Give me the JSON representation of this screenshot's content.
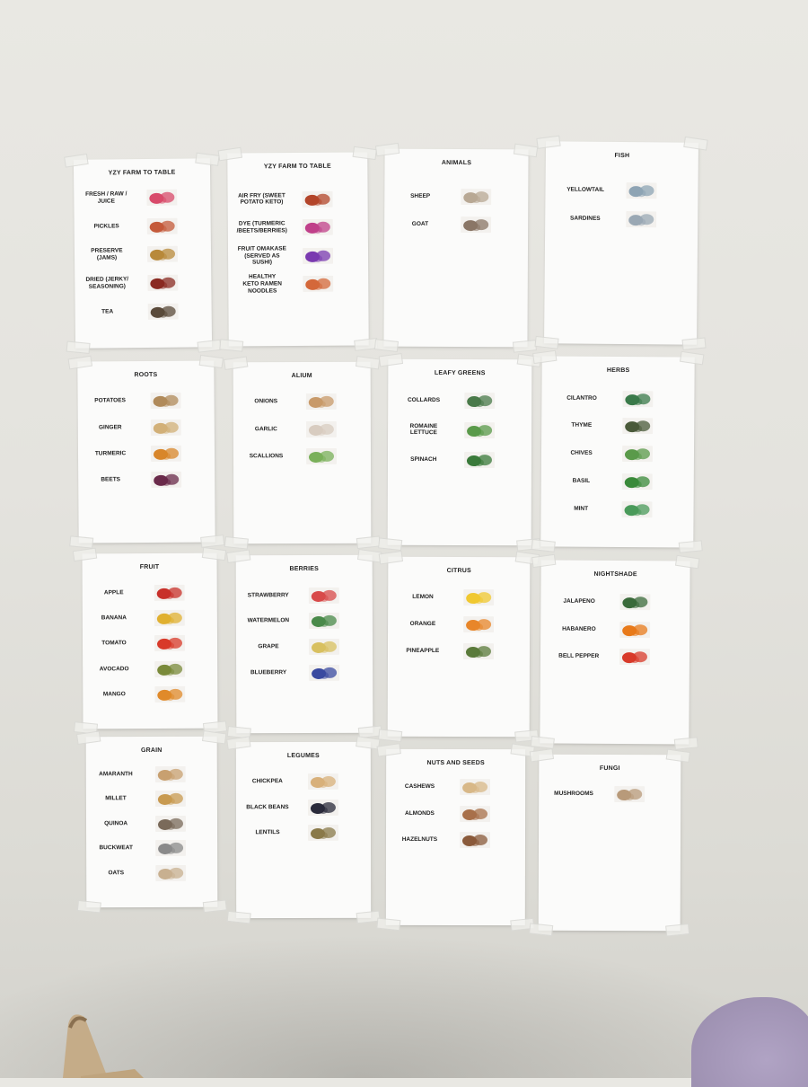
{
  "sheets": [
    {
      "title": "YZY FARM TO TABLE",
      "items": [
        {
          "label": "FRESH / RAW /\nJUICE",
          "img": "bottles-image",
          "color": "#d84a6a"
        },
        {
          "label": "PICKLES",
          "img": "pickle-jars-image",
          "color": "#c45a3a"
        },
        {
          "label": "PRESERVE\n(JAMS)",
          "img": "jam-spoons-image",
          "color": "#b8893a"
        },
        {
          "label": "DRIED (JERKY/\nSEASONING)",
          "img": "jerky-image",
          "color": "#8a2a22"
        },
        {
          "label": "TEA",
          "img": "tea-image",
          "color": "#5a4a3a"
        }
      ]
    },
    {
      "title": "YZY FARM TO TABLE",
      "items": [
        {
          "label": "AIR FRY (SWEET\nPOTATO KETO)",
          "img": "sweet-potato-fries-image",
          "color": "#b3452a"
        },
        {
          "label": "DYE (TURMERIC\n/BEETS/BERRIES)",
          "img": "dye-image",
          "color": "#c0408a"
        },
        {
          "label": "FRUIT OMAKASE\n(SERVED AS\nSUSHI)",
          "img": "fruit-sushi-image",
          "color": "#7a3ab0"
        },
        {
          "label": "HEALTHY\nKETO RAMEN\nNOODLES",
          "img": "ramen-packs-image",
          "color": "#d4683a"
        }
      ]
    },
    {
      "title": "ANIMALS",
      "items": [
        {
          "label": "SHEEP",
          "img": "sheep-image",
          "color": "#b8a894"
        },
        {
          "label": "GOAT",
          "img": "goat-image",
          "color": "#8a7666"
        }
      ]
    },
    {
      "title": "FISH",
      "items": [
        {
          "label": "YELLOWTAIL",
          "img": "yellowtail-image",
          "color": "#8ea4b4"
        },
        {
          "label": "SARDINES",
          "img": "sardines-image",
          "color": "#9aa8b4"
        }
      ]
    },
    {
      "title": "ROOTS",
      "items": [
        {
          "label": "POTATOES",
          "img": "potatoes-image",
          "color": "#b08a5a"
        },
        {
          "label": "GINGER",
          "img": "ginger-image",
          "color": "#d2b078"
        },
        {
          "label": "TURMERIC",
          "img": "turmeric-image",
          "color": "#d8862a"
        },
        {
          "label": "BEETS",
          "img": "beets-image",
          "color": "#6a2a4a"
        }
      ]
    },
    {
      "title": "ALIUM",
      "items": [
        {
          "label": "ONIONS",
          "img": "onions-image",
          "color": "#c89a6a"
        },
        {
          "label": "GARLIC",
          "img": "garlic-image",
          "color": "#d8ccc0"
        },
        {
          "label": "SCALLIONS",
          "img": "scallions-image",
          "color": "#7ab05a"
        }
      ]
    },
    {
      "title": "LEAFY GREENS",
      "items": [
        {
          "label": "COLLARDS",
          "img": "collards-image",
          "color": "#4a7a4a"
        },
        {
          "label": "ROMAINE\nLETTUCE",
          "img": "romaine-image",
          "color": "#5a9a4a"
        },
        {
          "label": "SPINACH",
          "img": "spinach-image",
          "color": "#3a7a3a"
        }
      ]
    },
    {
      "title": "HERBS",
      "items": [
        {
          "label": "CILANTRO",
          "img": "cilantro-image",
          "color": "#3a7a4a"
        },
        {
          "label": "THYME",
          "img": "thyme-image",
          "color": "#4a5a3a"
        },
        {
          "label": "CHIVES",
          "img": "chives-image",
          "color": "#5a9a4a"
        },
        {
          "label": "BASIL",
          "img": "basil-image",
          "color": "#3a8a3a"
        },
        {
          "label": "MINT",
          "img": "mint-image",
          "color": "#4a9a5a"
        }
      ]
    },
    {
      "title": "FRUIT",
      "items": [
        {
          "label": "APPLE",
          "img": "apple-image",
          "color": "#c8302a"
        },
        {
          "label": "BANANA",
          "img": "banana-image",
          "color": "#e0b030"
        },
        {
          "label": "TOMATO",
          "img": "tomato-image",
          "color": "#d83a2a"
        },
        {
          "label": "AVOCADO",
          "img": "avocado-image",
          "color": "#7a8a3a"
        },
        {
          "label": "MANGO",
          "img": "mango-image",
          "color": "#e08a2a"
        }
      ]
    },
    {
      "title": "BERRIES",
      "items": [
        {
          "label": "STRAWBERRY",
          "img": "strawberry-image",
          "color": "#d84a4a"
        },
        {
          "label": "WATERMELON",
          "img": "watermelon-image",
          "color": "#4a8a4a"
        },
        {
          "label": "GRAPE",
          "img": "grape-image",
          "color": "#d8c060"
        },
        {
          "label": "BLUEBERRY",
          "img": "blueberry-image",
          "color": "#3a4aa0"
        }
      ]
    },
    {
      "title": "CITRUS",
      "items": [
        {
          "label": "LEMON",
          "img": "lemon-image",
          "color": "#f0c830"
        },
        {
          "label": "ORANGE",
          "img": "orange-image",
          "color": "#e8862a"
        },
        {
          "label": "PINEAPPLE",
          "img": "pineapple-image",
          "color": "#5a7a3a"
        }
      ]
    },
    {
      "title": "NIGHTSHADE",
      "items": [
        {
          "label": "JALAPENO",
          "img": "jalapeno-image",
          "color": "#3a6a3a"
        },
        {
          "label": "HABANERO",
          "img": "habanero-image",
          "color": "#e87a1a"
        },
        {
          "label": "BELL PEPPER",
          "img": "bell-pepper-image",
          "color": "#d83a2a"
        }
      ]
    },
    {
      "title": "GRAIN",
      "items": [
        {
          "label": "AMARANTH",
          "img": "amaranth-image",
          "color": "#c8a070"
        },
        {
          "label": "MILLET",
          "img": "millet-image",
          "color": "#c89a50"
        },
        {
          "label": "QUINOA",
          "img": "quinoa-image",
          "color": "#7a6a5a"
        },
        {
          "label": "BUCKWEAT",
          "img": "buckwheat-image",
          "color": "#8a8a8a"
        },
        {
          "label": "OATS",
          "img": "oats-image",
          "color": "#c8b090"
        }
      ]
    },
    {
      "title": "LEGUMES",
      "items": [
        {
          "label": "CHICKPEA",
          "img": "chickpea-image",
          "color": "#d8b07a"
        },
        {
          "label": "BLACK BEANS",
          "img": "black-beans-image",
          "color": "#2a2a3a"
        },
        {
          "label": "LENTILS",
          "img": "lentils-image",
          "color": "#8a7a4a"
        }
      ]
    },
    {
      "title": "NUTS AND SEEDS",
      "items": [
        {
          "label": "CASHEWS",
          "img": "cashews-image",
          "color": "#d8b888"
        },
        {
          "label": "ALMONDS",
          "img": "almonds-image",
          "color": "#a8704a"
        },
        {
          "label": "HAZELNUTS",
          "img": "hazelnuts-image",
          "color": "#8a5a3a"
        }
      ]
    },
    {
      "title": "FUNGI",
      "items": [
        {
          "label": "MUSHROOMS",
          "img": "mushrooms-image",
          "color": "#b89a7a"
        }
      ]
    }
  ]
}
